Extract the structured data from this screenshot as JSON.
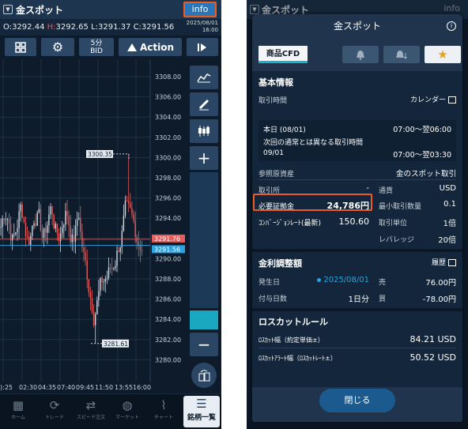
{
  "left": {
    "header": {
      "title": "金スポット",
      "info_label": "info"
    },
    "ohlc": {
      "o_label": "O:",
      "o": "3292.44",
      "h_label": "H:",
      "h": "3292.65",
      "l_label": "L:",
      "l": "3291.37",
      "c_label": "C:",
      "c": "3291.56",
      "date": "2025/08/01",
      "time": "16:00"
    },
    "toolbar": {
      "interval_top": "5分",
      "interval_bottom": "BID",
      "action_label": "Action"
    },
    "price_ticks": [
      "3308.00",
      "3306.00",
      "3304.00",
      "3302.00",
      "3300.00",
      "3298.00",
      "3296.00",
      "3294.00",
      "3292.00",
      "3290.00",
      "3288.00",
      "3286.00",
      "3284.00",
      "3282.00",
      "3280.00"
    ],
    "high_marker": "3300.35",
    "low_marker": "3281.61",
    "ask_tag": "3291.76",
    "bid_tag": "3291.56",
    "time_ticks": [
      "):25",
      "02:30",
      "04:35",
      "07:40",
      "09:45",
      "11:50",
      "13:55",
      "16:00"
    ],
    "nav": [
      {
        "label": "ホーム",
        "icon": "grid-icon"
      },
      {
        "label": "トレード",
        "icon": "trade-icon"
      },
      {
        "label": "スピード注文",
        "icon": "speed-order-icon"
      },
      {
        "label": "マーケット",
        "icon": "globe-icon"
      },
      {
        "label": "チャート",
        "icon": "chart-icon"
      },
      {
        "label": "銘柄一覧",
        "icon": "list-icon"
      }
    ],
    "colors": {
      "accent": "#ee5a24",
      "ask": "#e35d5d",
      "bid": "#2aa3e0",
      "teal": "#19a8c0"
    }
  },
  "right": {
    "bg_header": {
      "title": "金スポット",
      "info_label": "info"
    },
    "modal": {
      "title": "金スポット",
      "tab_cfd": "商品CFD",
      "basic_heading": "基本情報",
      "trading_hours_label": "取引時間",
      "calendar_label": "カレンダー",
      "today_label": "本日 (08/01)",
      "today_hours": "07:00～翌06:00",
      "next_label": "次回の通常とは異なる取引時間",
      "next_date": "09/01",
      "next_hours": "07:00～翌03:30",
      "ref_asset_label": "参照原資産",
      "ref_asset_value": "金のスポット取引",
      "exchange_label": "取引所",
      "exchange_value": "-",
      "currency_label": "通貨",
      "currency_value": "USD",
      "margin_label": "必要証拠金",
      "margin_value": "24,786円",
      "min_qty_label": "最小取引数量",
      "min_qty_value": "0.1",
      "conv_rate_label": "ｺﾝﾊﾞｰｼﾞｮﾝﾚｰﾄ(最新)",
      "conv_rate_value": "150.60",
      "unit_label": "取引単位",
      "unit_value": "1倍",
      "leverage_label": "レバレッジ",
      "leverage_value": "20倍",
      "interest_heading": "金利調整額",
      "history_label": "履歴",
      "occur_label": "発生日",
      "occur_value": "2025/08/01",
      "sell_label": "売",
      "sell_value": "76.00円",
      "grant_days_label": "付与日数",
      "grant_days_value": "1日分",
      "buy_label": "買",
      "buy_value": "-78.00円",
      "losscut_heading": "ロスカットルール",
      "losscut_width_label": "ﾛｽｶｯﾄ幅（約定単価±）",
      "losscut_width_value": "84.21 USD",
      "losscut_alert_label": "ﾛｽｶｯﾄｱﾗｰﾄ幅（ﾛｽｶｯﾄﾚｰﾄ±）",
      "losscut_alert_value": "50.52 USD",
      "close_label": "閉じる"
    },
    "bg_footer_label": "チャート"
  }
}
